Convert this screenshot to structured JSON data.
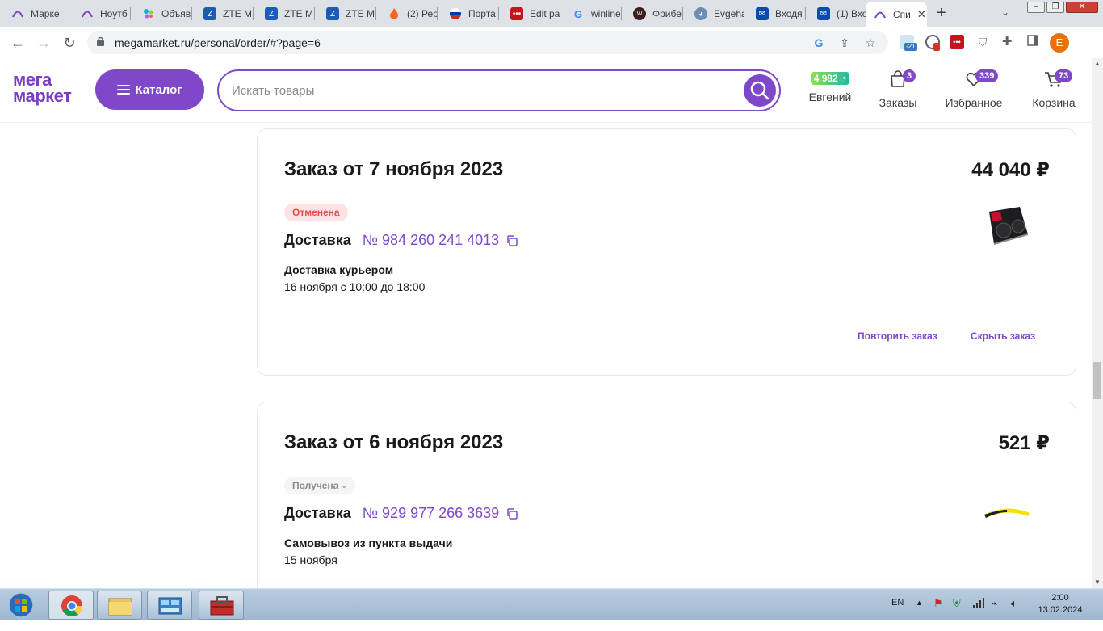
{
  "browser": {
    "tabs": [
      {
        "label": "Марке",
        "icon": "megamarket-favicon",
        "color": "#7b3fc4"
      },
      {
        "label": "Ноутб",
        "icon": "megamarket-favicon",
        "color": "#7b3fc4"
      },
      {
        "label": "Объяв",
        "icon": "avito-favicon",
        "color": "#00aaff"
      },
      {
        "label": "ZTE MI",
        "icon": "zte-favicon",
        "color": "#1e5bb8"
      },
      {
        "label": "ZTE MI",
        "icon": "zte-favicon",
        "color": "#1e5bb8"
      },
      {
        "label": "ZTE MI",
        "icon": "zte-favicon",
        "color": "#1e5bb8"
      },
      {
        "label": "(2) Рер",
        "icon": "flame-favicon",
        "color": "#f06a1d"
      },
      {
        "label": "Порта",
        "icon": "russia-flag-favicon",
        "color": "#d52b1e"
      },
      {
        "label": "Edit pa",
        "icon": "edit-favicon",
        "color": "#c4151c"
      },
      {
        "label": "winline",
        "icon": "google-favicon",
        "color": "#4285f4"
      },
      {
        "label": "Фрибе",
        "icon": "freebet-favicon",
        "color": "#c23b22"
      },
      {
        "label": "Evgeha",
        "icon": "dog-favicon",
        "color": "#6b8fb3"
      },
      {
        "label": "Входя",
        "icon": "mail-favicon",
        "color": "#0a4bb0"
      },
      {
        "label": "(1) Вхо",
        "icon": "mail-favicon",
        "color": "#0a4bb0"
      },
      {
        "label": "Спи",
        "icon": "megamarket-favicon",
        "color": "#7b3fc4"
      }
    ],
    "url": "megamarket.ru/personal/order/#?page=6",
    "extensions": [
      {
        "name": "weather-extension-icon",
        "badge": "-21",
        "color": "#4aa3df"
      },
      {
        "name": "chrome-extension-icon",
        "badge": "1",
        "color": "#5f6368"
      },
      {
        "name": "dots-extension-icon",
        "badge": "",
        "color": "#c4151c"
      }
    ],
    "profile_initial": "E"
  },
  "header": {
    "logo_line1": "мега",
    "logo_line2": "маркет",
    "catalog_label": "Каталог",
    "search_placeholder": "Искать товары",
    "bonus_amount": "4 982",
    "user_label": "Евгений",
    "orders_label": "Заказы",
    "orders_count": "3",
    "favorites_label": "Избранное",
    "favorites_count": "339",
    "cart_label": "Корзина",
    "cart_count": "73"
  },
  "orders": [
    {
      "title": "Заказ от 7 ноября 2023",
      "price": "44 040 ₽",
      "status": "Отменена",
      "delivery_label": "Доставка",
      "tracking": "№ 984 260 241 4013",
      "method": "Доставка курьером",
      "when": "16 ноября с 10:00 до 18:00",
      "product": "graphics-card-image",
      "repeat_label": "Повторить заказ",
      "hide_label": "Скрыть заказ"
    },
    {
      "title": "Заказ от 6 ноября 2023",
      "price": "521 ₽",
      "status": "Получена",
      "delivery_label": "Доставка",
      "tracking": "№ 929 977 266 3639",
      "method": "Самовывоз из пункта выдачи",
      "when": "15 ноября",
      "product": "yellow-item-image"
    }
  ],
  "taskbar": {
    "language": "EN",
    "time": "2:00",
    "date": "13.02.2024"
  },
  "colors": {
    "accent": "#7f48c8",
    "cancelled": "#e24d4d",
    "cancelled_bg": "#fde3e3"
  }
}
